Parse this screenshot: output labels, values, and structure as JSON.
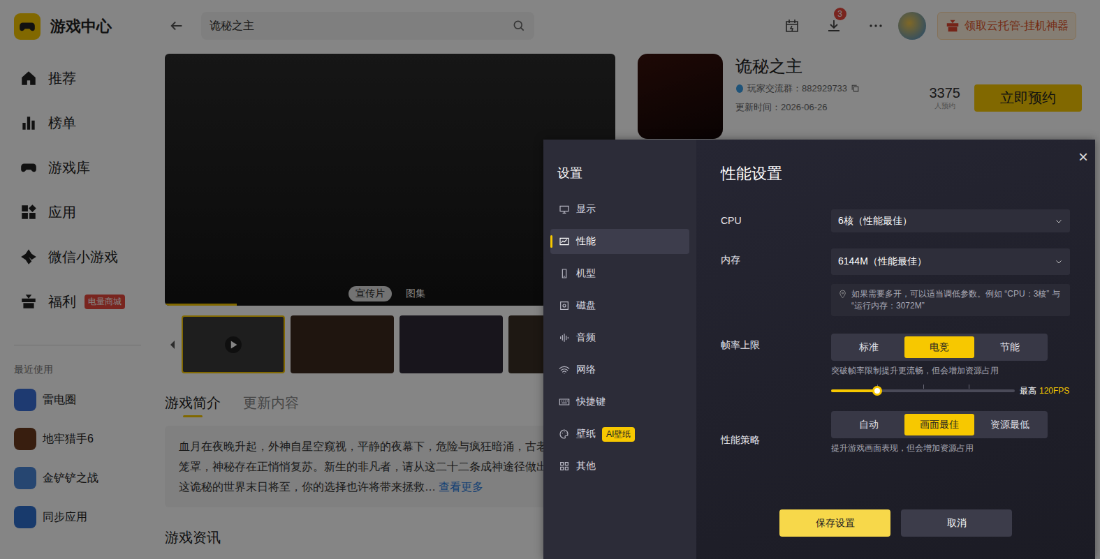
{
  "app": {
    "title": "游戏中心"
  },
  "sidebar": {
    "items": [
      {
        "label": "推荐",
        "selected": false
      },
      {
        "label": "榜单",
        "selected": false
      },
      {
        "label": "游戏库",
        "selected": false
      },
      {
        "label": "应用",
        "selected": false
      },
      {
        "label": "微信小游戏",
        "selected": false
      },
      {
        "label": "福利",
        "selected": false,
        "badge": "电量商城"
      }
    ],
    "recent_title": "最近使用",
    "recent": [
      {
        "label": "雷电圈",
        "color": "#3b6fd8"
      },
      {
        "label": "地牢猎手6",
        "color": "#6b3a1e"
      },
      {
        "label": "金铲铲之战",
        "color": "#4a86d8"
      },
      {
        "label": "同步应用",
        "color": "#2f6fcf"
      }
    ]
  },
  "topbar": {
    "search": "诡秘之主",
    "download_badge": "3",
    "promo": "领取云托管-挂机神器"
  },
  "media": {
    "progress": 0.16,
    "tabs": [
      {
        "label": "宣传片",
        "selected": true
      },
      {
        "label": "图集",
        "selected": false
      }
    ],
    "thumbnails": [
      {
        "kind": "video"
      },
      {
        "kind": "image"
      },
      {
        "kind": "image"
      },
      {
        "kind": "image"
      }
    ]
  },
  "game": {
    "title": "诡秘之主",
    "group": "玩家交流群：882929733",
    "updated": "更新时间：2026-06-26",
    "count": "3375",
    "count_label": "人预约",
    "action": "立即预约"
  },
  "tabs": [
    {
      "label": "游戏简介",
      "selected": true
    },
    {
      "label": "更新内容",
      "selected": false
    }
  ],
  "description": {
    "lines": [
      "血月在夜晚升起，外神自星空窥视，平静的夜幕下，危险与疯狂暗涌，古老",
      "笼罩，神秘存在正悄悄复苏。新生的非凡者，请从这二十二条成神途径做出",
      "这诡秘的世界末日将至，你的选择也许将带来拯救…"
    ],
    "more": "查看更多"
  },
  "news_title": "游戏资讯",
  "dialog": {
    "title": "设置",
    "close": "×",
    "nav": [
      {
        "label": "显示",
        "selected": false
      },
      {
        "label": "性能",
        "selected": true
      },
      {
        "label": "机型",
        "selected": false
      },
      {
        "label": "磁盘",
        "selected": false
      },
      {
        "label": "音频",
        "selected": false
      },
      {
        "label": "网络",
        "selected": false
      },
      {
        "label": "快捷键",
        "selected": false
      },
      {
        "label": "壁纸",
        "selected": false,
        "badge": "AI壁纸"
      },
      {
        "label": "其他",
        "selected": false
      }
    ],
    "heading": "性能设置",
    "fields": [
      {
        "label": "CPU",
        "value": "6核（性能最佳）"
      },
      {
        "label": "内存",
        "value": "6144M（性能最佳）"
      }
    ],
    "hint": "如果需要多开，可以适当调低参数。例如 “CPU：3核” 与 “运行内存：3072M”",
    "frame": {
      "label": "帧率上限",
      "options": [
        {
          "label": "标准",
          "selected": false
        },
        {
          "label": "电竞",
          "selected": true
        },
        {
          "label": "节能",
          "selected": false
        }
      ],
      "note": "突破帧率限制提升更流畅，但会增加资源占用",
      "level": 0.25,
      "max_label": "最高",
      "max_value": "120FPS"
    },
    "strategy": {
      "label": "性能策略",
      "options": [
        {
          "label": "自动",
          "selected": false
        },
        {
          "label": "画面最佳",
          "selected": true
        },
        {
          "label": "资源最低",
          "selected": false
        }
      ],
      "note": "提升游戏画面表现，但会增加资源占用"
    },
    "buttons": [
      {
        "label": "保存设置",
        "primary": true
      },
      {
        "label": "取消",
        "primary": false
      }
    ]
  }
}
